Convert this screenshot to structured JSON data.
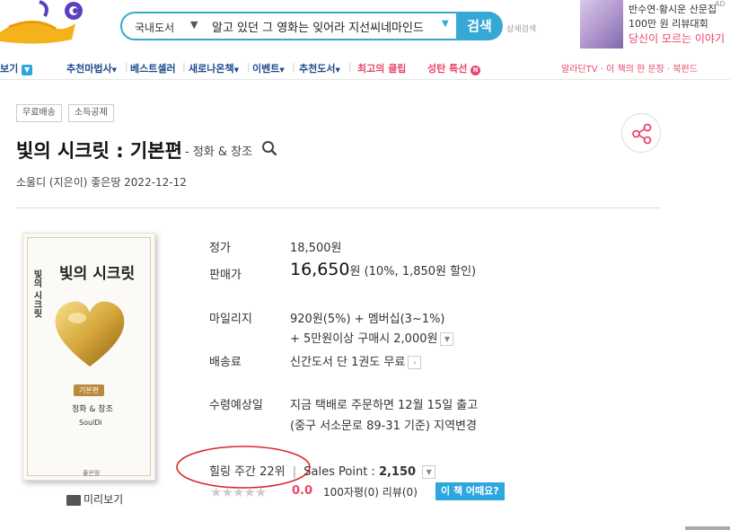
{
  "search": {
    "category": "국내도서",
    "query": "알고 있던 그 영화는 잊어라 지선씨네마인드",
    "button": "검색",
    "detail": "상세검색"
  },
  "ad": {
    "line1": "반수연·황시운 산문집",
    "line2": "100만 원 리뷰대회",
    "line3": "당신이 모르는 이야기",
    "badge": "AD"
  },
  "nav": {
    "left": [
      {
        "label": "보기",
        "color": "#1e4b8c"
      },
      {
        "label": "추천마법사",
        "color": "#1e4b8c"
      },
      {
        "label": "베스트셀러",
        "color": "#1e4b8c"
      },
      {
        "label": "새로나온책",
        "color": "#1e4b8c"
      },
      {
        "label": "이벤트",
        "color": "#1e4b8c"
      },
      {
        "label": "추천도서",
        "color": "#1e4b8c"
      },
      {
        "label": "최고의 클립",
        "color": "#e8466a"
      },
      {
        "label": "성탄 특선",
        "color": "#e8466a"
      }
    ],
    "right": "알라딘TV · 이 책의 한 문장 · 북펀드"
  },
  "book": {
    "tags": [
      "무료배송",
      "소득공제"
    ],
    "title": "빛의 시크릿 : 기본편",
    "subtitle": "- 정화 & 창조",
    "authors": "소울디 (지은이)  좋은땅  2022-12-12",
    "cover": {
      "title": "빛의 시크릿",
      "spine": "빛의 시크릿",
      "edition": "기본편",
      "sub": "정화 & 창조",
      "author": "SoulDi",
      "publisher": "좋은땅"
    },
    "preview": "미리보기"
  },
  "info": {
    "list_price_label": "정가",
    "list_price": "18,500원",
    "sale_label": "판매가",
    "sale_price": "16,650",
    "sale_unit": "원",
    "sale_discount": "(10%, 1,850원 할인)",
    "mileage_label": "마일리지",
    "mileage_line1": "920원(5%) + 멤버십(3~1%)",
    "mileage_line2": "+ 5만원이상 구매시 2,000원",
    "shipping_label": "배송료",
    "shipping": "신간도서 단 1권도 무료",
    "eta_label": "수령예상일",
    "eta_line1": "지금 택배로 주문하면 12월 15일 출고",
    "eta_line2": "(중구 서소문로 89-31 기준) 지역변경",
    "rank": "힐링 주간 22위",
    "rank_sep": "|",
    "sales_point_label": "Sales Point :",
    "sales_point": "2,150",
    "rating": "0.0",
    "reviews": "100자평(0)  리뷰(0)",
    "how_button": "이 책 어때요?"
  }
}
